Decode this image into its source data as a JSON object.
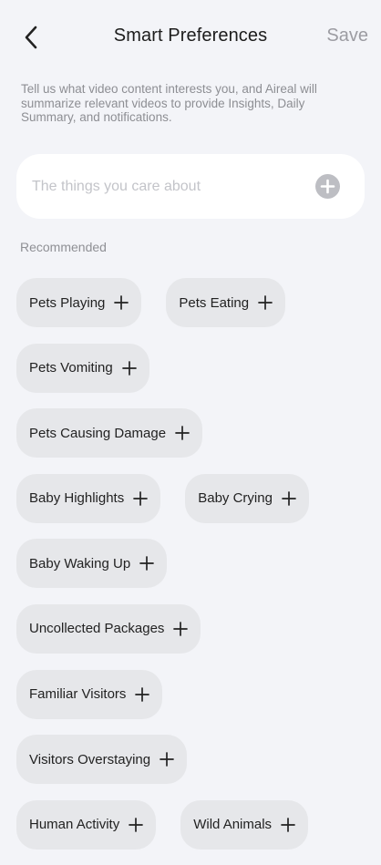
{
  "header": {
    "title": "Smart Preferences",
    "save_label": "Save",
    "back_icon": "chevron-left-icon"
  },
  "description": "Tell us what video content interests you, and Aireal will summarize relevant videos to provide Insights, Daily Summary, and notifications.",
  "search": {
    "placeholder": "The things you care about",
    "value": "",
    "add_icon": "plus-circle-icon"
  },
  "recommended": {
    "label": "Recommended",
    "rows": [
      [
        "Pets Playing",
        "Pets Eating"
      ],
      [
        "Pets Vomiting"
      ],
      [
        "Pets Causing Damage"
      ],
      [
        "Baby Highlights",
        "Baby Crying"
      ],
      [
        "Baby Waking Up"
      ],
      [
        "Uncollected Packages"
      ],
      [
        "Familiar Visitors"
      ],
      [
        "Visitors Overstaying"
      ],
      [
        "Human Activity",
        "Wild Animals"
      ]
    ]
  },
  "colors": {
    "background": "#f3f4f8",
    "chip": "#e6e7ea",
    "muted_text": "#8d8e93",
    "save_disabled": "#9c9ca2"
  }
}
